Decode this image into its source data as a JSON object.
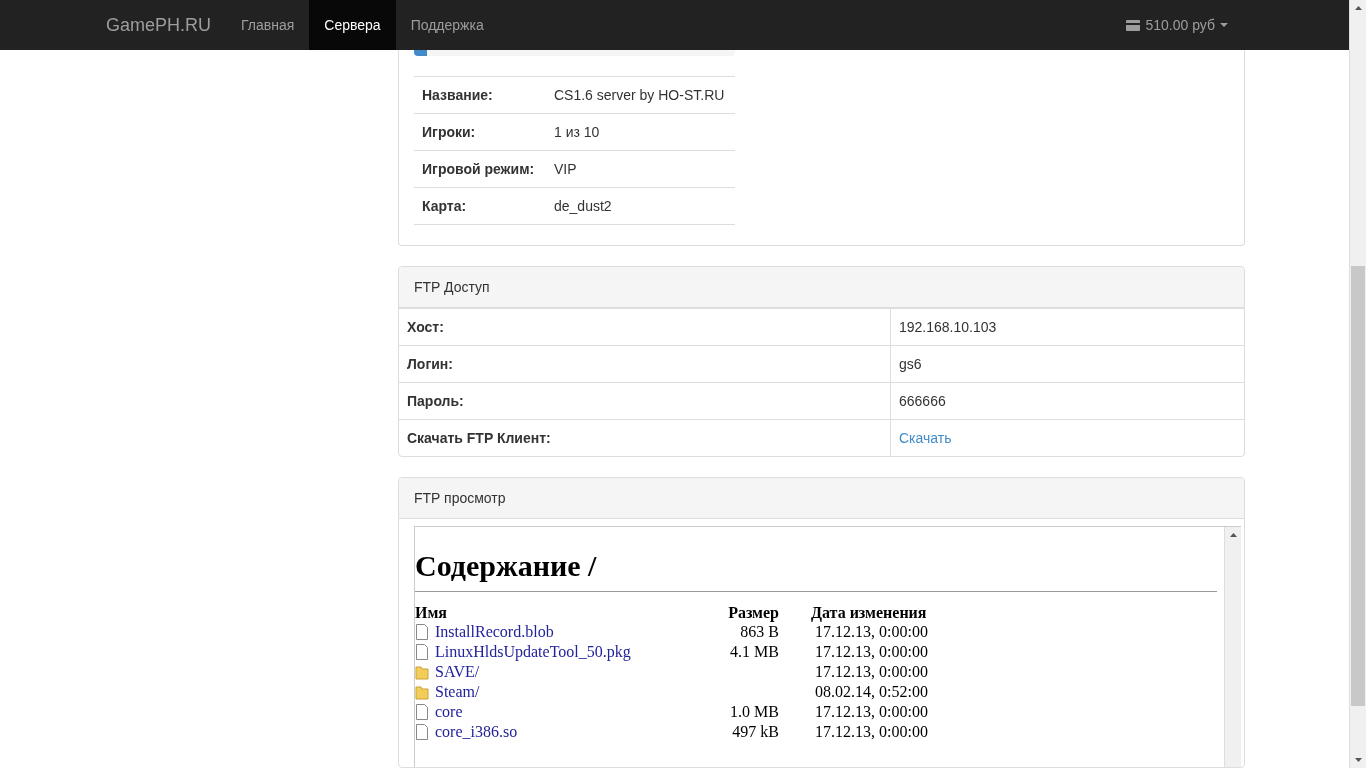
{
  "navbar": {
    "brand": "GamePH.RU",
    "items": [
      {
        "label": "Главная",
        "selected": false
      },
      {
        "label": "Сервера",
        "selected": true
      },
      {
        "label": "Поддержка",
        "selected": false
      }
    ],
    "balance": "510.00 руб"
  },
  "server_panel": {
    "progress": {
      "level": 0.04
    },
    "rows": [
      {
        "label": "Название:",
        "value": "CS1.6 server by HO-ST.RU"
      },
      {
        "label": "Игроки:",
        "value": "1 из 10"
      },
      {
        "label": "Игровой режим:",
        "value": "VIP"
      },
      {
        "label": "Карта:",
        "value": "de_dust2"
      }
    ]
  },
  "ftp_access": {
    "title": "FTP Доступ",
    "rows": [
      {
        "label": "Хост:",
        "value": "192.168.10.103",
        "kind": "text"
      },
      {
        "label": "Логин:",
        "value": "gs6",
        "kind": "text"
      },
      {
        "label": "Пароль:",
        "value": "666666",
        "kind": "text"
      },
      {
        "label": "Скачать FTP Клиент:",
        "value": "Скачать",
        "kind": "link"
      }
    ]
  },
  "ftp_browser": {
    "title": "FTP просмотр",
    "heading": "Содержание /",
    "columns": [
      "Имя",
      "Размер",
      "Дата изменения"
    ],
    "files": [
      {
        "name": "InstallRecord.blob",
        "size": "863 B",
        "date": "17.12.13, 0:00:00",
        "kind": "file"
      },
      {
        "name": "LinuxHldsUpdateTool_50.pkg",
        "size": "4.1 MB",
        "date": "17.12.13, 0:00:00",
        "kind": "file"
      },
      {
        "name": "SAVE/",
        "date": "17.12.13, 0:00:00",
        "kind": "folder"
      },
      {
        "name": "Steam/",
        "date": "08.02.14, 0:52:00",
        "kind": "folder"
      },
      {
        "name": "core",
        "size": "1.0 MB",
        "date": "17.12.13, 0:00:00",
        "kind": "file"
      },
      {
        "name": "core_i386.so",
        "size": "497 kB",
        "date": "17.12.13, 0:00:00",
        "kind": "file"
      }
    ]
  }
}
